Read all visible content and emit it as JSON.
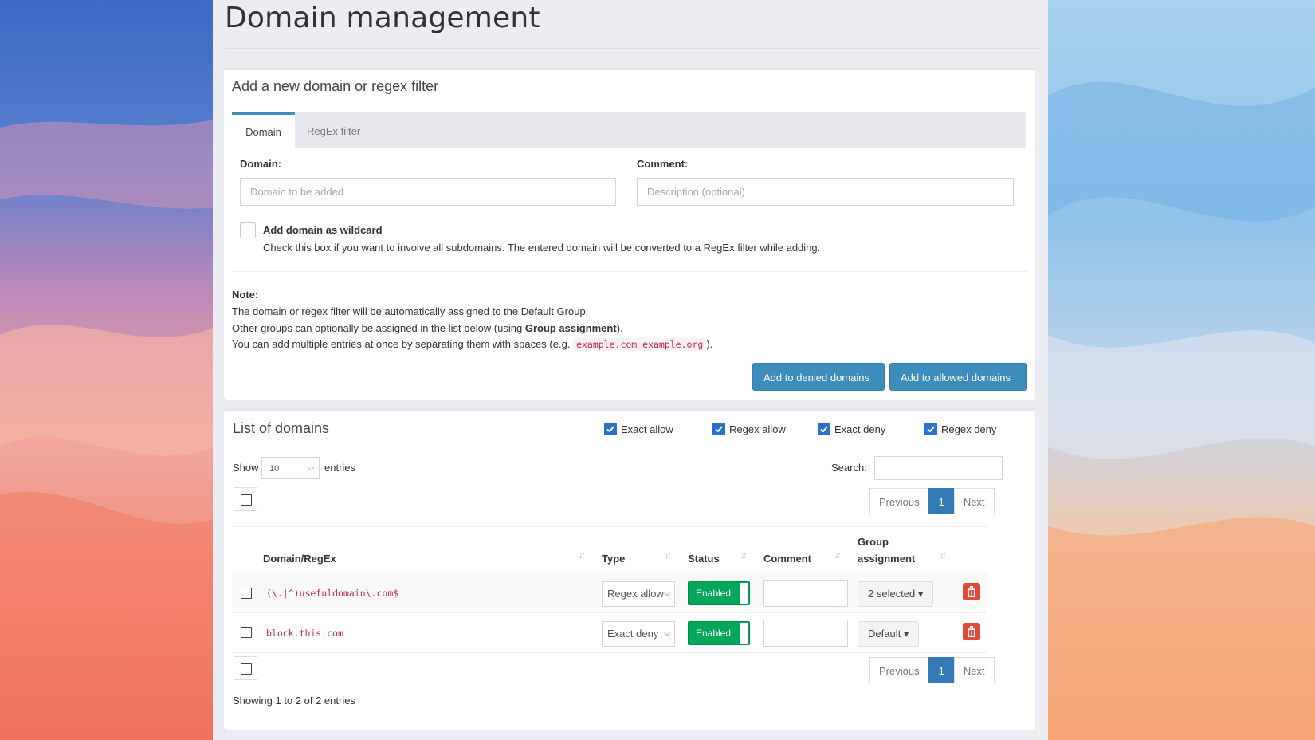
{
  "page": {
    "title": "Domain management"
  },
  "add_box": {
    "title": "Add a new domain or regex filter",
    "tabs": [
      {
        "label": "Domain",
        "active": true
      },
      {
        "label": "RegEx filter",
        "active": false
      }
    ],
    "domain_label": "Domain:",
    "domain_placeholder": "Domain to be added",
    "domain_value": "",
    "comment_label": "Comment:",
    "comment_placeholder": "Description (optional)",
    "comment_value": "",
    "wildcard_label": "Add domain as wildcard",
    "wildcard_checked": false,
    "wildcard_help": "Check this box if you want to involve all subdomains. The entered domain will be converted to a RegEx filter while adding.",
    "note_title": "Note:",
    "note_line1": "The domain or regex filter will be automatically assigned to the Default Group.",
    "note_line2_prefix": "Other groups can optionally be assigned in the list below (using ",
    "note_line2_bold": "Group assignment",
    "note_line2_suffix": ").",
    "note_line3_prefix": "You can add multiple entries at once by separating them with spaces (e.g. ",
    "note_line3_code": "example.com example.org",
    "note_line3_suffix": ").",
    "btn_deny": "Add to denied domains",
    "btn_allow": "Add to allowed domains"
  },
  "list_box": {
    "title": "List of domains",
    "filters": [
      {
        "label": "Exact allow",
        "checked": true
      },
      {
        "label": "Regex allow",
        "checked": true
      },
      {
        "label": "Exact deny",
        "checked": true
      },
      {
        "label": "Regex deny",
        "checked": true
      }
    ],
    "show_label": "Show",
    "show_value": "10",
    "entries_label": "entries",
    "search_label": "Search:",
    "search_value": "",
    "pager": {
      "previous": "Previous",
      "current": "1",
      "next": "Next"
    },
    "columns": {
      "domain": "Domain/RegEx",
      "type": "Type",
      "status": "Status",
      "comment": "Comment",
      "group_line1": "Group",
      "group_line2": "assignment"
    },
    "rows": [
      {
        "domain": "(\\.|^)usefuldomain\\.com$",
        "type": "Regex allow",
        "status": "Enabled",
        "comment": "",
        "group": "2 selected"
      },
      {
        "domain": "block.this.com",
        "type": "Exact deny",
        "status": "Enabled",
        "comment": "",
        "group": "Default"
      }
    ],
    "info": "Showing 1 to 2 of 2 entries"
  },
  "colors": {
    "primary": "#3c8dbc",
    "success": "#00a65a",
    "danger": "#dd4b39",
    "code": "#c7254e"
  }
}
